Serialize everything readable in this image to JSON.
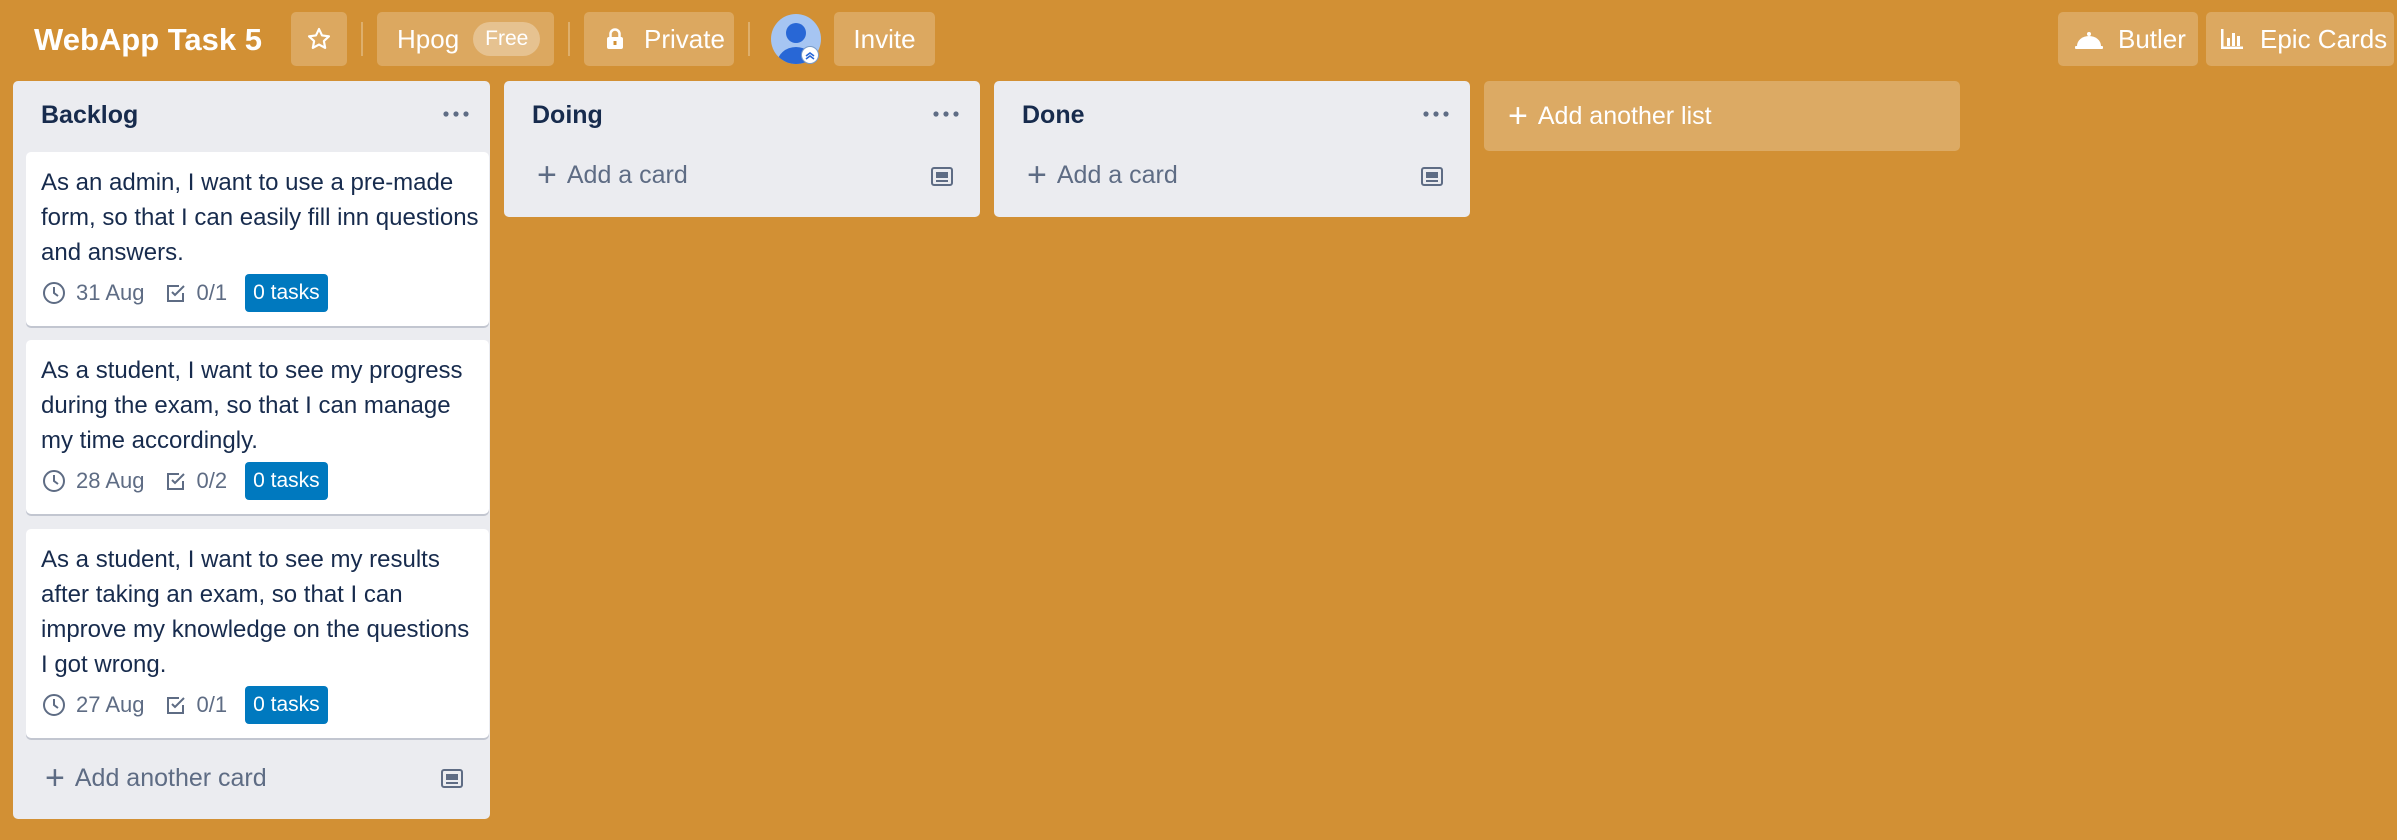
{
  "header": {
    "board_title": "WebApp Task 5",
    "workspace_name": "Hpog",
    "workspace_badge": "Free",
    "visibility": "Private",
    "invite": "Invite",
    "butler": "Butler",
    "epic_cards": "Epic Cards"
  },
  "lists": [
    {
      "title": "Backlog",
      "cards": [
        {
          "text": "As an admin, I want to use a pre-made form, so that I can easily fill inn questions and answers.",
          "due": "31 Aug",
          "checklist": "0/1",
          "tasks": "0 tasks"
        },
        {
          "text": "As a student, I want to see my progress during the exam, so that I can manage my time accordingly.",
          "due": "28 Aug",
          "checklist": "0/2",
          "tasks": "0 tasks"
        },
        {
          "text": "As a student, I want to see my results after taking an exam, so that I can improve my knowledge on the questions I got wrong.",
          "due": "27 Aug",
          "checklist": "0/1",
          "tasks": "0 tasks"
        }
      ],
      "add_label": "Add another card"
    },
    {
      "title": "Doing",
      "cards": [],
      "add_label": "Add a card"
    },
    {
      "title": "Done",
      "cards": [],
      "add_label": "Add a card"
    }
  ],
  "add_list_label": "Add another list",
  "colors": {
    "board_background": "#D29034",
    "list_background": "#EBECF0",
    "tasks_badge": "#0079BF",
    "text": "#172B4D",
    "muted_text": "#5E6C84"
  },
  "icons": [
    "star-icon",
    "lock-icon",
    "user-avatar-icon",
    "butler-icon",
    "chart-icon",
    "more-icon",
    "clock-icon",
    "checklist-icon",
    "plus-icon",
    "template-icon"
  ]
}
